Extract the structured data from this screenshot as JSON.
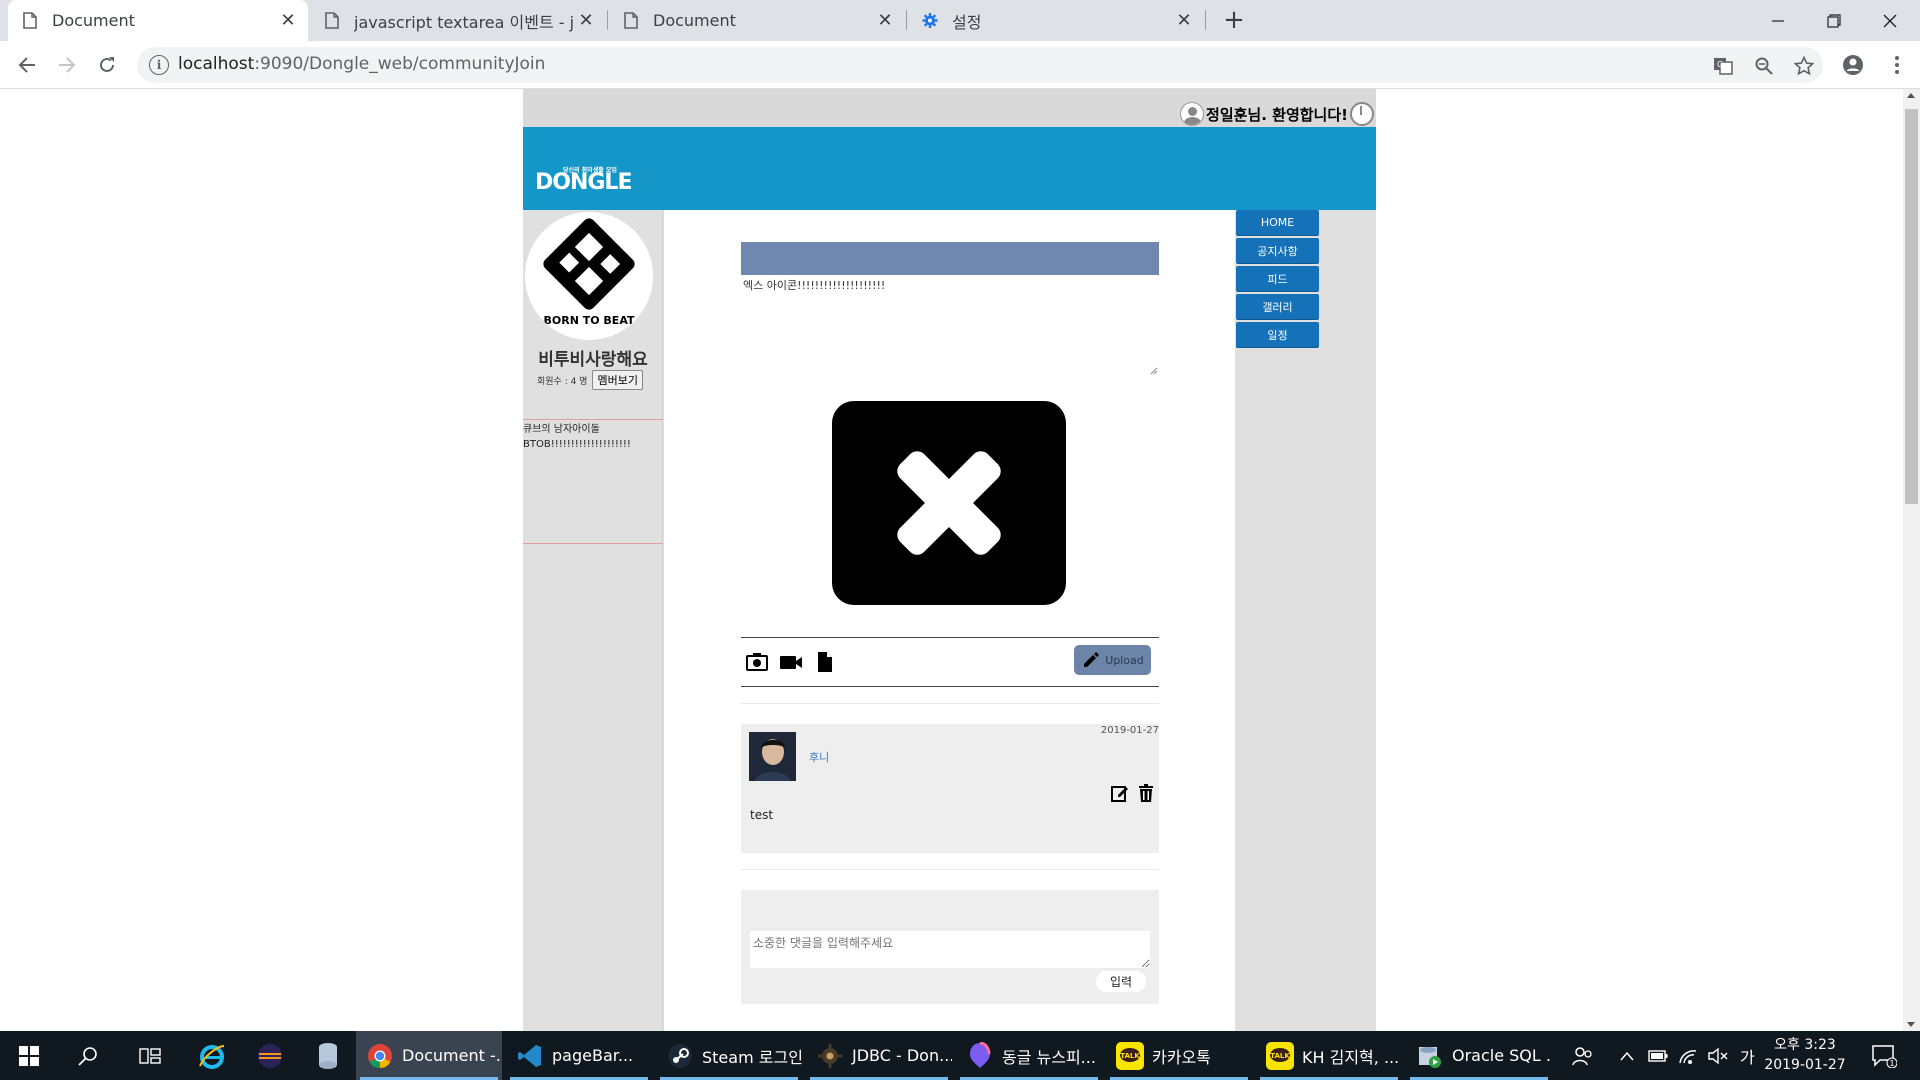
{
  "browser": {
    "tabs": [
      {
        "title": "Document",
        "active": true
      },
      {
        "title": "javascript textarea 이벤트 - jQue",
        "active": false
      },
      {
        "title": "Document",
        "active": false
      },
      {
        "title": "설정",
        "active": false
      }
    ],
    "url_host": "localhost",
    "url_path": ":9090/Dongle_web/communityJoin"
  },
  "site": {
    "welcome": "정일훈님. 환영합니다!",
    "logo_tag": "당신의 취미생활 모임",
    "logo_name": "DONGLE",
    "community": {
      "name": "비투비사랑해요",
      "member_count_label": "회원수 : 4 명",
      "member_button": "멤버보기",
      "profile_caption": "BORN TO BEAT",
      "intro_line1": "큐브의 남자아이돌",
      "intro_line2": "BTOB!!!!!!!!!!!!!!!!!!!!"
    },
    "menu": [
      "HOME",
      "공지사항",
      "피드",
      "갤러리",
      "일정"
    ],
    "post": {
      "text": "엑스 아이콘!!!!!!!!!!!!!!!!!!!!",
      "upload_label": "Upload"
    },
    "comment": {
      "date": "2019-01-27",
      "author": "후니",
      "text": "test"
    },
    "reply": {
      "placeholder": "소중한 댓글을 입력해주세요",
      "submit": "입력"
    },
    "colors": {
      "banner": "#1596c8",
      "menu": "#1572b8",
      "title_bar": "#7088b0",
      "upload_button": "#6b84a8"
    }
  },
  "taskbar": {
    "items": [
      "Document -...",
      "pageBar...",
      "Steam 로그인",
      "JDBC - Don...",
      "동글 뉴스피...",
      "카카오톡",
      "KH 김지혁, ...",
      "Oracle SQL ..."
    ],
    "ime": "가",
    "time": "오후 3:23",
    "date": "2019-01-27",
    "notifications": "1"
  }
}
